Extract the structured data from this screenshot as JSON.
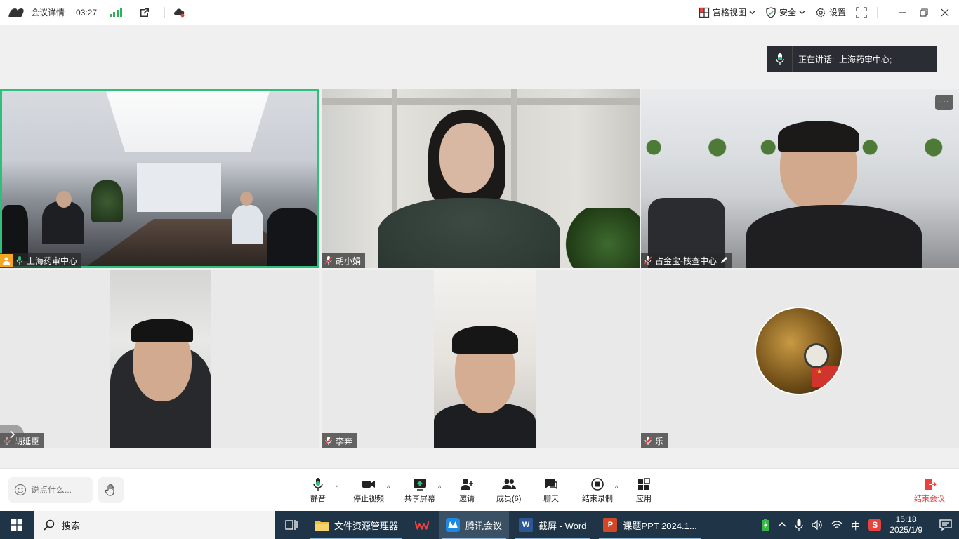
{
  "topbar": {
    "title": "会议详情",
    "time": "03:27",
    "view_label": "宫格视图",
    "security_label": "安全",
    "settings_label": "设置"
  },
  "speaking": {
    "label": "正在讲话:",
    "name": "上海药审中心;"
  },
  "participants": [
    {
      "name": "上海药审中心",
      "active": true,
      "mic": "on"
    },
    {
      "name": "胡小娟",
      "mic": "off"
    },
    {
      "name": "占金宝-核查中心",
      "mic": "off"
    },
    {
      "name": "胡延臣",
      "mic": "off"
    },
    {
      "name": "李奔",
      "mic": "off"
    },
    {
      "name": "乐",
      "mic": "off"
    }
  ],
  "toolbar": {
    "chat_placeholder": "说点什么...",
    "mute_label": "静音",
    "video_label": "停止视频",
    "share_label": "共享屏幕",
    "invite_label": "邀请",
    "members_label": "成员(6)",
    "chat_label": "聊天",
    "record_label": "结束录制",
    "apps_label": "应用",
    "end_label": "结束会议"
  },
  "taskbar": {
    "search_label": "搜索",
    "apps": [
      {
        "label": "文件资源管理器"
      },
      {
        "label": "腾讯会议"
      },
      {
        "label": "截屏 - Word"
      },
      {
        "label": "课题PPT 2024.1..."
      }
    ],
    "ime": "中",
    "clock_time": "15:18",
    "clock_date": "2025/1/9"
  },
  "colors": {
    "active_speaker_border": "#2fbf7d",
    "end_meeting": "#e8423f",
    "taskbar_bg": "#1f3547"
  }
}
